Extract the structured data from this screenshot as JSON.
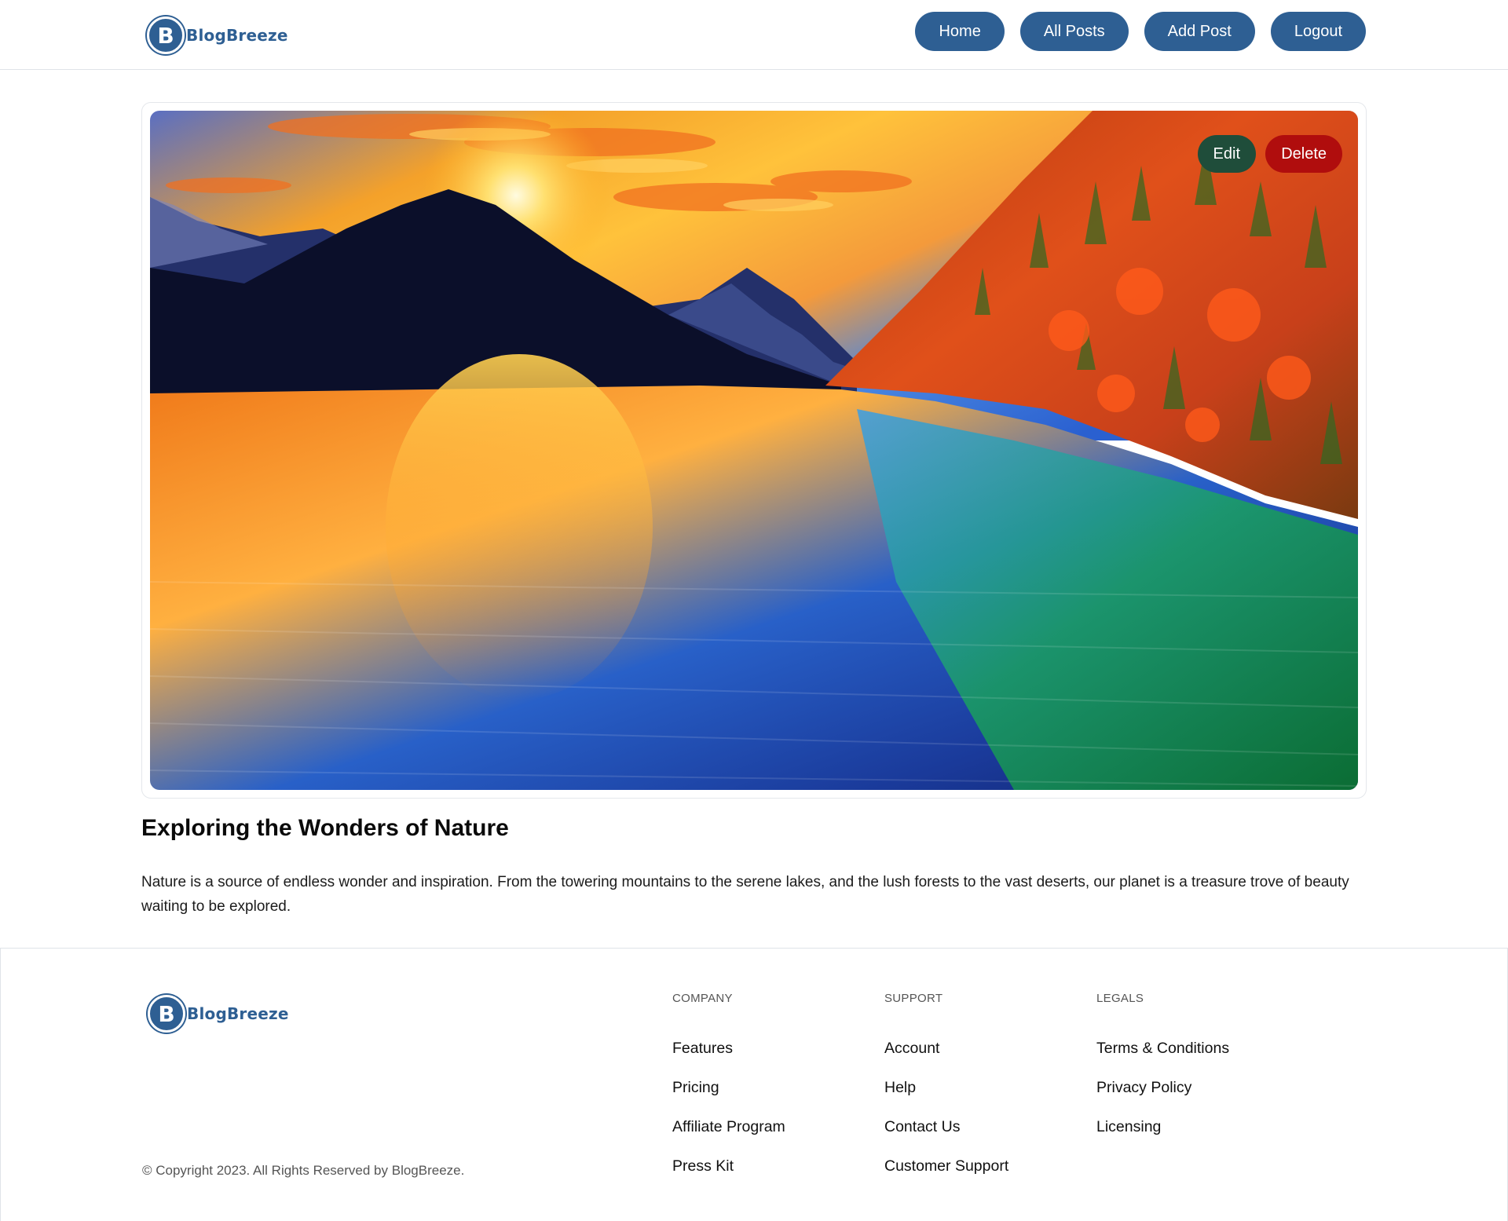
{
  "brand": {
    "initial": "B",
    "name": "BlogBreeze",
    "color": "#2e5f93"
  },
  "nav": {
    "items": [
      {
        "label": "Home"
      },
      {
        "label": "All Posts"
      },
      {
        "label": "Add Post"
      },
      {
        "label": "Logout"
      }
    ]
  },
  "post": {
    "image_description": "mountain-lake-sunset",
    "actions": {
      "edit_label": "Edit",
      "delete_label": "Delete"
    },
    "title": "Exploring the Wonders of Nature",
    "body": "Nature is a source of endless wonder and inspiration. From the towering mountains to the serene lakes, and the lush forests to the vast deserts, our planet is a treasure trove of beauty waiting to be explored."
  },
  "footer": {
    "copyright": "© Copyright 2023. All Rights Reserved by BlogBreeze.",
    "columns": [
      {
        "heading": "COMPANY",
        "links": [
          "Features",
          "Pricing",
          "Affiliate Program",
          "Press Kit"
        ]
      },
      {
        "heading": "SUPPORT",
        "links": [
          "Account",
          "Help",
          "Contact Us",
          "Customer Support"
        ]
      },
      {
        "heading": "LEGALS",
        "links": [
          "Terms & Conditions",
          "Privacy Policy",
          "Licensing"
        ]
      }
    ]
  },
  "colors": {
    "primary": "#2e5f93",
    "edit_button": "#1f4d3a",
    "delete_button": "#b00d0d"
  }
}
